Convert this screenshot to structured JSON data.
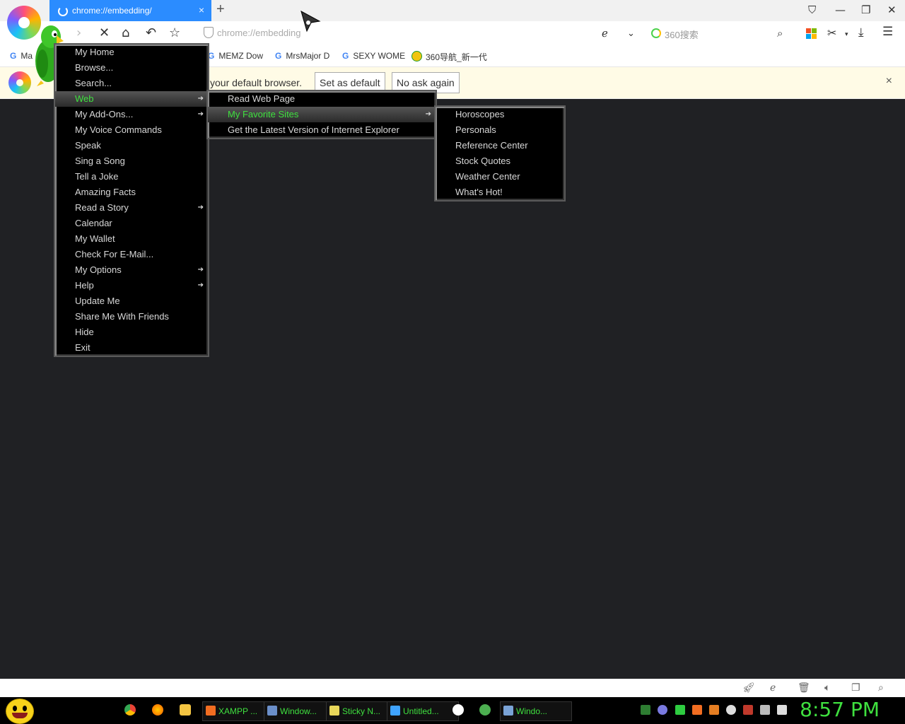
{
  "browser": {
    "tab_title": "chrome://embedding/",
    "tab_close": "×",
    "new_tab": "+",
    "address": "chrome://embedding",
    "search_engine_label": "360搜索",
    "window_controls": [
      "minimize",
      "restore",
      "close"
    ]
  },
  "bookmarks": [
    {
      "label": "Ma",
      "icon": "google-icon"
    },
    {
      "label": "MEMZ Dow",
      "icon": "google-icon"
    },
    {
      "label": "MrsMajor D",
      "icon": "google-icon"
    },
    {
      "label": "SEXY WOME",
      "icon": "google-icon"
    },
    {
      "label": "360导航_新一代",
      "icon": "360-icon"
    }
  ],
  "notification": {
    "text": "your default browser.",
    "set_default": "Set as default",
    "no_ask": "No ask again",
    "close": "×"
  },
  "menu_main": {
    "items": [
      {
        "label": "My Home",
        "submenu": false
      },
      {
        "label": "Browse...",
        "submenu": false
      },
      {
        "label": "Search...",
        "submenu": false
      },
      {
        "label": "Web",
        "submenu": true,
        "selected": true
      },
      {
        "label": "My Add-Ons...",
        "submenu": true
      },
      {
        "label": "My Voice Commands",
        "submenu": false
      },
      {
        "label": "Speak",
        "submenu": false
      },
      {
        "label": "Sing a Song",
        "submenu": false
      },
      {
        "label": "Tell a Joke",
        "submenu": false
      },
      {
        "label": "Amazing Facts",
        "submenu": false
      },
      {
        "label": "Read a Story",
        "submenu": true
      },
      {
        "label": "Calendar",
        "submenu": false
      },
      {
        "label": "My Wallet",
        "submenu": false
      },
      {
        "label": "Check For E-Mail...",
        "submenu": false
      },
      {
        "label": "My Options",
        "submenu": true
      },
      {
        "label": "Help",
        "submenu": true
      },
      {
        "label": "Update Me",
        "submenu": false
      },
      {
        "label": "Share Me With Friends",
        "submenu": false
      },
      {
        "label": "Hide",
        "submenu": false
      },
      {
        "label": "Exit",
        "submenu": false
      }
    ]
  },
  "menu_web": {
    "items": [
      {
        "label": "Read Web Page",
        "submenu": false
      },
      {
        "label": "My Favorite Sites",
        "submenu": true,
        "selected": true
      },
      {
        "label": "Get the Latest Version of Internet Explorer",
        "submenu": false
      }
    ]
  },
  "menu_fav": {
    "items": [
      {
        "label": "Horoscopes"
      },
      {
        "label": "Personals"
      },
      {
        "label": "Reference Center"
      },
      {
        "label": "Stock Quotes"
      },
      {
        "label": "Weather Center"
      },
      {
        "label": "What's Hot!"
      }
    ]
  },
  "taskbar": {
    "tasks": [
      {
        "label": "XAMPP ...",
        "color": "#f26d21"
      },
      {
        "label": "Window...",
        "color": "#6b8fc9"
      },
      {
        "label": "Sticky N...",
        "color": "#e8d75a"
      },
      {
        "label": "Untitled...",
        "color": "#3fa3ff"
      },
      {
        "label": "Windo...",
        "color": "#7aa3d6"
      }
    ],
    "clock": "8:57 PM"
  },
  "colors": {
    "menu_highlight_text": "#3fe03f",
    "tab_active": "#2b8cff",
    "content_bg": "#202124"
  }
}
